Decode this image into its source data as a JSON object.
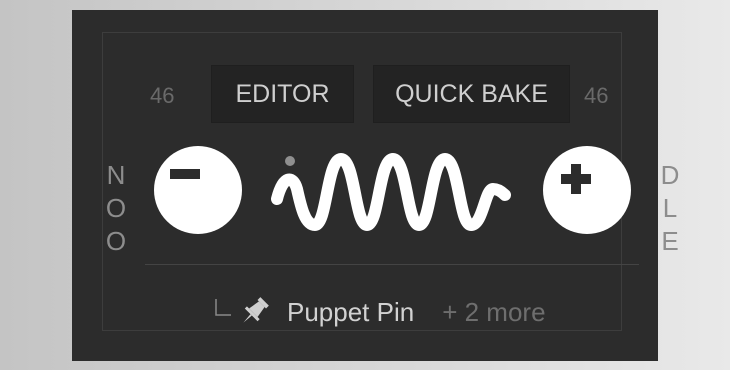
{
  "panel": {
    "left_number": "46",
    "right_number": "46",
    "tabs": {
      "editor": "EDITOR",
      "quick_bake": "QUICK BAKE"
    },
    "left_vertical_text": [
      "N",
      "O",
      "O"
    ],
    "right_vertical_text": [
      "D",
      "L",
      "E"
    ],
    "buttons": {
      "decrease_icon": "minus-icon",
      "increase_icon": "plus-icon"
    },
    "wave_icon": "wave-icon",
    "footer": {
      "corner_icon": "corner-arrow-icon",
      "pin_icon": "pin-icon",
      "pin_label": "Puppet Pin",
      "more_label": "+ 2 more"
    }
  }
}
